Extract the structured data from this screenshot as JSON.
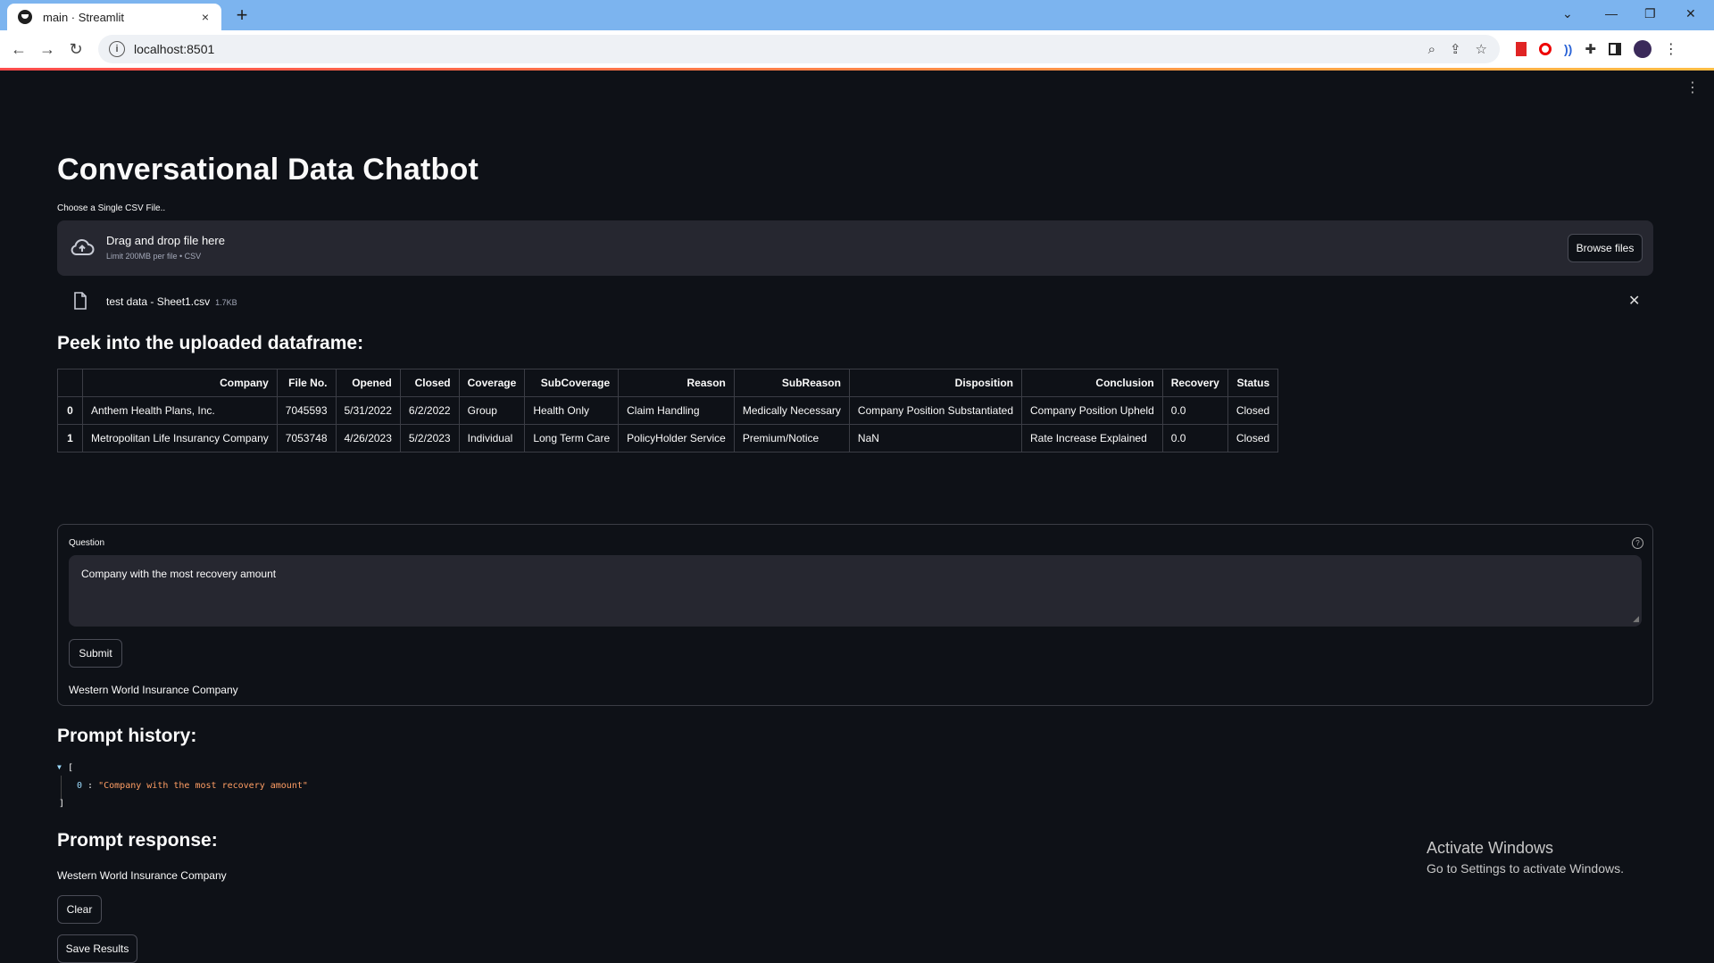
{
  "browser": {
    "tab_title": "main · Streamlit",
    "tab_close": "×",
    "new_tab": "+",
    "url": "localhost:8501"
  },
  "app": {
    "title": "Conversational Data Chatbot",
    "uploader": {
      "label": "Choose a Single CSV File..",
      "drop_text": "Drag and drop file here",
      "limit_text": "Limit 200MB per file • CSV",
      "browse_label": "Browse files",
      "file_name": "test data - Sheet1.csv",
      "file_size": "1.7KB"
    },
    "peek_heading": "Peek into the uploaded dataframe:",
    "table": {
      "columns": [
        "",
        "Company",
        "File No.",
        "Opened",
        "Closed",
        "Coverage",
        "SubCoverage",
        "Reason",
        "SubReason",
        "Disposition",
        "Conclusion",
        "Recovery",
        "Status"
      ],
      "rows": [
        [
          "0",
          "Anthem Health Plans, Inc.",
          "7045593",
          "5/31/2022",
          "6/2/2022",
          "Group",
          "Health Only",
          "Claim Handling",
          "Medically Necessary",
          "Company Position Substantiated",
          "Company Position Upheld",
          "0.0",
          "Closed"
        ],
        [
          "1",
          "Metropolitan Life Insurancy Company",
          "7053748",
          "4/26/2023",
          "5/2/2023",
          "Individual",
          "Long Term Care",
          "PolicyHolder Service",
          "Premium/Notice",
          "NaN",
          "Rate Increase Explained",
          "0.0",
          "Closed"
        ]
      ]
    },
    "form": {
      "question_label": "Question",
      "question_value": "Company with the most recovery amount",
      "submit_label": "Submit",
      "answer": "Western World Insurance Company"
    },
    "history_heading": "Prompt history:",
    "history": {
      "open": "[",
      "close": "]",
      "item_key": "0",
      "item_value": "\"Company with the most recovery amount\""
    },
    "response_heading": "Prompt response:",
    "response_text": "Western World Insurance Company",
    "clear_label": "Clear",
    "save_label": "Save Results"
  },
  "os": {
    "activate_title": "Activate Windows",
    "activate_sub": "Go to Settings to activate Windows."
  },
  "icons": {
    "cloud": "cloud-upload-icon",
    "file": "file-icon",
    "close": "close-icon"
  }
}
